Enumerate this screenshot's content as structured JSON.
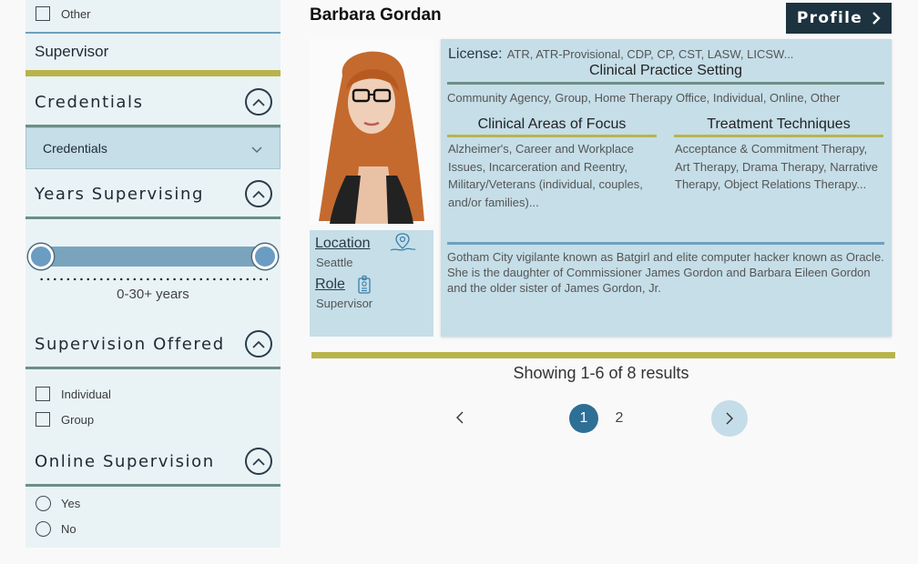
{
  "sidebar": {
    "top_option": {
      "label": "Other"
    },
    "supervisor_label": "Supervisor",
    "credentials": {
      "title": "Credentials",
      "dropdown_value": "Credentials"
    },
    "years": {
      "title": "Years Supervising",
      "range_label": "0-30+ years",
      "range_min": 0,
      "range_max": 1
    },
    "supervision_offered": {
      "title": "Supervision Offered",
      "options": [
        "Individual",
        "Group"
      ]
    },
    "online_supervision": {
      "title": "Online Supervision",
      "options": [
        "Yes",
        "No"
      ]
    }
  },
  "profile": {
    "name": "Barbara Gordan",
    "profile_button": "Profile",
    "location_label": "Location",
    "location_value": "Seattle",
    "role_label": "Role",
    "role_value": "Supervisor",
    "license_label": "License:",
    "license_value": "ATR, ATR-Provisional, CDP, CP, CST, LASW, LICSW...",
    "practice_setting_title": "Clinical Practice Setting",
    "practice_setting_value": "Community Agency, Group, Home Therapy Office, Individual, Online, Other",
    "areas_title": "Clinical Areas of Focus",
    "areas_value": "Alzheimer's, Career and Workplace Issues, Incarceration and Reentry, Military/Veterans (individual, couples, and/or families)...",
    "techniques_title": "Treatment Techniques",
    "techniques_value": "Acceptance & Commitment Therapy, Art Therapy, Drama Therapy, Narrative Therapy, Object Relations Therapy...",
    "bio": "Gotham City vigilante known as Batgirl and elite computer hacker known as Oracle. She is the daughter of Commissioner James Gordon and Barbara Eileen Gordon and the older sister of James Gordon, Jr."
  },
  "results": {
    "summary": "Showing 1-6 of 8 results",
    "pages": [
      "1",
      "2"
    ],
    "current_page": "1"
  },
  "colors": {
    "accent_olive": "#b8b44a",
    "teal_rule": "#6d8f86",
    "dark_navy": "#1d3340",
    "page_active": "#2e6f96"
  },
  "icons": [
    "chevron-up-icon",
    "chevron-down-icon",
    "location-pin-icon",
    "badge-icon",
    "chevron-right-icon",
    "chevron-left-icon"
  ]
}
